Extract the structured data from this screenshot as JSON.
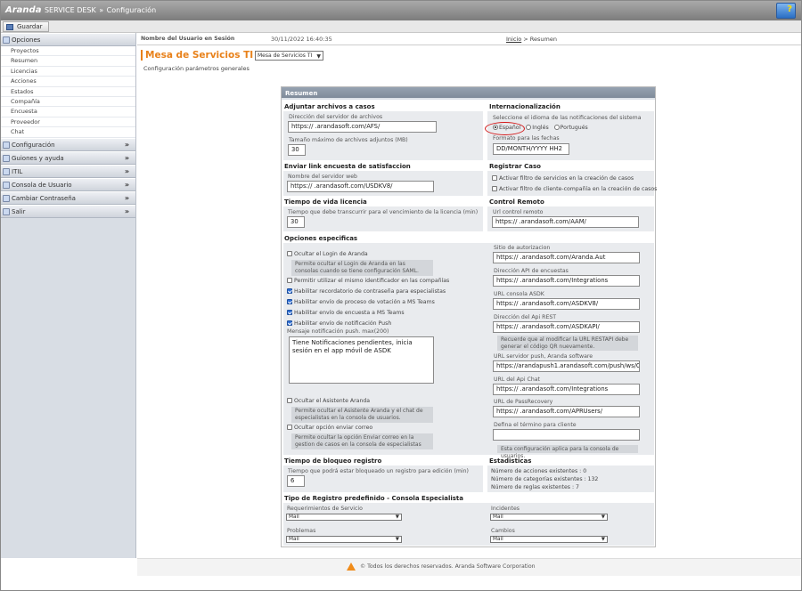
{
  "app": {
    "title_brand": "Aranda",
    "title_product": "SERVICE DESK",
    "title_section": "Configuración"
  },
  "toolbar": {
    "save_label": "Guardar"
  },
  "sidebar": {
    "opciones_label": "Opciones",
    "opciones_items": [
      "Proyectos",
      "Resumen",
      "Licencias",
      "Acciones",
      "Estados",
      "Compañía",
      "Encuesta",
      "Proveedor",
      "Chat"
    ],
    "sections": [
      "Configuración",
      "Guiones y ayuda",
      "ITIL",
      "Consola de Usuario",
      "Cambiar Contraseña",
      "Salir"
    ],
    "chevron": "»"
  },
  "userbar": {
    "label": "Nombre del Usuario en Sesión",
    "datetime": "30/11/2022 16:40:35",
    "crumb_link": "Inicio",
    "crumb_rest": " > Resumen"
  },
  "page": {
    "title": "Mesa de Servicios TI",
    "project_select": "Mesa de Servicios TI",
    "subtitle": "Configuración parámetros generales"
  },
  "summary": {
    "header": "Resumen",
    "adjuntar": {
      "title": "Adjuntar archivos a casos",
      "server_label": "Dirección del servidor de archivos",
      "server_value": "https://            .arandasoft.com/AFS/",
      "size_label": "Tamaño máximo de archivos adjuntos (MB)",
      "size_value": "30"
    },
    "intl": {
      "title": "Internacionalización",
      "lang_label": "Seleccione el idioma de las notificaciones del sistema",
      "opt_es": "Español",
      "opt_en": "Inglés",
      "opt_pt": "Portugués",
      "date_label": "Formato para las fechas",
      "date_value": "DD/MONTH/YYYY HH2"
    },
    "encuesta": {
      "title": "Enviar link encuesta de satisfaccion",
      "web_label": "Nombre del servidor web",
      "web_value": "https://           .arandasoft.com/USDKV8/"
    },
    "registrar": {
      "title": "Registrar Caso",
      "opt1": "Activar filtro de servicios en la creación de casos",
      "opt2": "Activar filtro de cliente-compañía en la creación de casos"
    },
    "vida": {
      "title": "Tiempo de vida licencia",
      "label": "Tiempo que debe transcurrir para el vencimiento de la licencia (min)",
      "value": "30"
    },
    "remoto": {
      "title": "Control Remoto",
      "label": "Url control remoto",
      "value": "https://            .arandasoft.com/AAM/"
    },
    "opciones": {
      "title": "Opciones especificas",
      "login": "Ocultar el Login de Aranda",
      "login_note": "Permite ocultar el Login de Aranda en las consolas cuando se tiene configuración SAML.",
      "same_id": "Permitir utilizar el mismo identificador en las compañías",
      "reminder": "Habilitar recordatorio de contraseña para especialistas",
      "vote": "Habilitar envío de proceso de votación a MS Teams",
      "survey": "Habilitar envío de encuesta a MS Teams",
      "push": "Habilitar envío de notificación Push",
      "push_msg_label": "Mensaje notificación push. max(200)",
      "push_msg_pre": "Tiene Notificaciones pendientes, inicia sesión en ",
      "push_msg_link": "el app móvil",
      "push_msg_post": " de ASDK",
      "assistant": "Ocultar el Asistente Aranda",
      "assistant_note": "Permite ocultar el Asistente Aranda y el chat de especialistas en la consola de usuarios.",
      "mail": "Ocultar opción enviar correo",
      "mail_note": "Permite ocultar la opción Enviar correo en la gestion de casos en la consola de especialistas",
      "auth_label": "Sitio de autorizacion",
      "auth_value": "https://            .arandasoft.com/Aranda.Aut",
      "api_survey_label": "Dirección API de encuestas",
      "api_survey_value": "https://            .arandasoft.com/Integrations",
      "asdk_label": "URL consola ASDK",
      "asdk_value": "https://            .arandasoft.com/ASDKV8/",
      "rest_label": "Dirección del Api REST",
      "rest_value": "https://            .arandasoft.com/ASDKAPI/",
      "rest_note": "Recuerde que al modificar la URL RESTAPI debe generar el código QR nuevamente.",
      "push_srv_label": "URL servidor push, Aranda software",
      "push_srv_value": "https://arandapush1.arandasoft.com/push/ws/Cli",
      "chat_label": "URL del Api Chat",
      "chat_value": "https://            .arandasoft.com/Integrations",
      "pass_label": "URL de PassRecovery",
      "pass_value": "https://            .arandasoft.com/APRUsers/",
      "term_label": "Defina el término para cliente",
      "term_value": "",
      "term_note": "Esta configuración aplica para la consola de usuarios."
    },
    "bloqueo": {
      "title": "Tiempo de bloqueo registro",
      "label": "Tiempo que podrá estar bloqueado un registro para edición (min)",
      "value": "6"
    },
    "stats": {
      "title": "Estadisticas",
      "acciones": "Número de acciones existentes : 0",
      "categorias": "Número de categorías existentes : 132",
      "reglas": "Número de reglas existentes : 7"
    },
    "tipo": {
      "title": "Tipo de Registro predefinido - Consola Especialista",
      "req_label": "Requerimientos de Servicio",
      "req_value": "Mail",
      "inc_label": "Incidentes",
      "inc_value": "Mail",
      "prob_label": "Problemas",
      "prob_value": "Mail",
      "camb_label": "Cambios",
      "camb_value": "Mail"
    }
  },
  "footer": {
    "text": "© Todos los derechos reservados. Aranda Software Corporation"
  },
  "colors": {
    "accent": "#e8811a",
    "header_gray": "#8a96a5",
    "highlight_red": "#d31919"
  }
}
